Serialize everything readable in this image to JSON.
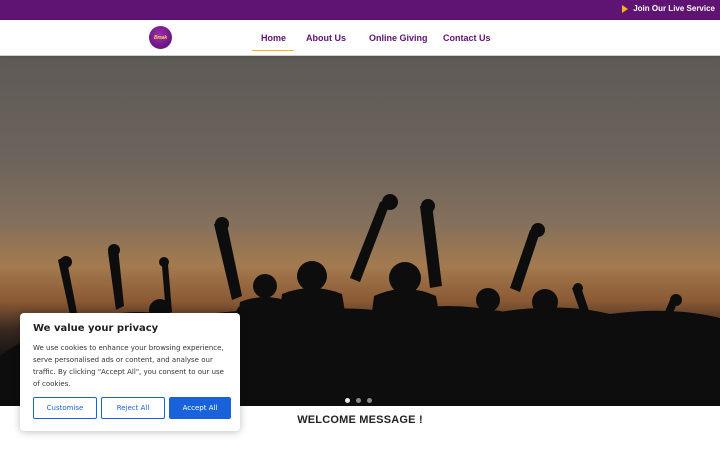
{
  "topbar": {
    "live_label": "Join Our Live Service",
    "icon": "play-icon",
    "background": "#5f1372",
    "icon_color": "#f2b417"
  },
  "header": {
    "logo_text": "Break",
    "nav": [
      {
        "label": "Home",
        "active": true
      },
      {
        "label": "About Us"
      },
      {
        "label": "Online Giving"
      },
      {
        "label": "Contact Us"
      }
    ],
    "nav_color": "#5f1372",
    "active_underline_color": "#f2b417"
  },
  "hero": {
    "slides": 3,
    "active_slide": 1
  },
  "welcome": {
    "title": "WELCOME MESSAGE !"
  },
  "cookie_banner": {
    "title": "We value your privacy",
    "body": "We use cookies to enhance your browsing experience, serve personalised ads or content, and analyse our traffic. By clicking \"Accept All\", you consent to our use of cookies.",
    "customise_label": "Customise",
    "reject_label": "Reject All",
    "accept_label": "Accept All",
    "accent_color": "#1863dc"
  }
}
